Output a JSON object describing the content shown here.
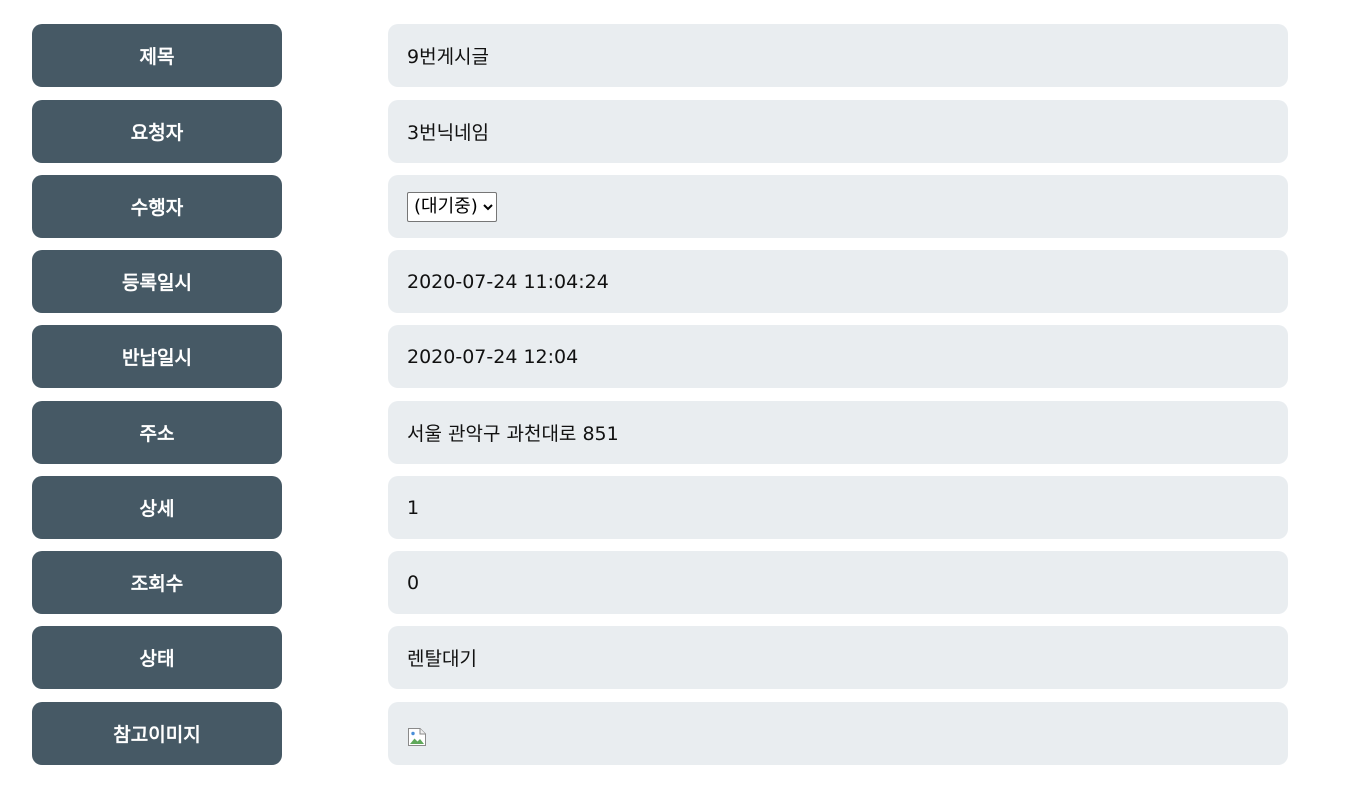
{
  "rows": [
    {
      "label": "제목",
      "value": "9번게시글"
    },
    {
      "label": "요청자",
      "value": "3번닉네임"
    },
    {
      "label": "수행자",
      "select_value": "(대기중)"
    },
    {
      "label": "등록일시",
      "value": "2020-07-24 11:04:24"
    },
    {
      "label": "반납일시",
      "value": "2020-07-24 12:04"
    },
    {
      "label": "주소",
      "value": "서울 관악구 과천대로 851"
    },
    {
      "label": "상세",
      "value": "1"
    },
    {
      "label": "조회수",
      "value": "0"
    },
    {
      "label": "상태",
      "value": "렌탈대기"
    },
    {
      "label": "참고이미지",
      "image_icon": "broken-image-icon"
    }
  ],
  "colors": {
    "label_background": "#465965",
    "value_background": "#e9edf0"
  }
}
